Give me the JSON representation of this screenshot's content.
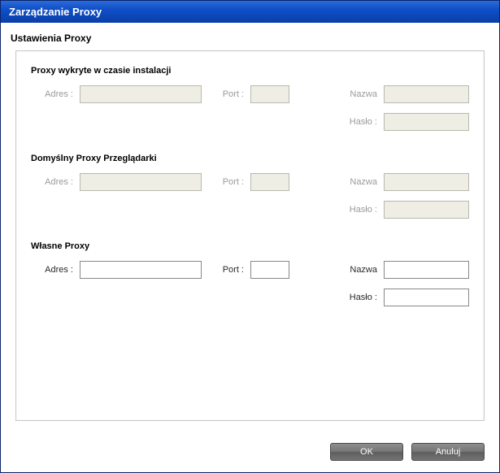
{
  "window": {
    "title": "Zarządzanie Proxy"
  },
  "subheader": "Ustawienia Proxy",
  "sections": {
    "detected": {
      "title": "Proxy wykryte w czasie instalacji",
      "enabled": false,
      "addr_label": "Adres :",
      "port_label": "Port :",
      "name_label": "Nazwa",
      "pass_label": "Hasło :",
      "addr": "",
      "port": "",
      "name": "",
      "pass": ""
    },
    "default": {
      "title": "Domyślny Proxy Przeglądarki",
      "enabled": false,
      "addr_label": "Adres :",
      "port_label": "Port :",
      "name_label": "Nazwa",
      "pass_label": "Hasło :",
      "addr": "",
      "port": "",
      "name": "",
      "pass": ""
    },
    "own": {
      "title": "Własne Proxy",
      "enabled": true,
      "addr_label": "Adres :",
      "port_label": "Port :",
      "name_label": "Nazwa",
      "pass_label": "Hasło :",
      "addr": "",
      "port": "",
      "name": "",
      "pass": ""
    }
  },
  "buttons": {
    "ok": "OK",
    "cancel": "Anuluj"
  }
}
